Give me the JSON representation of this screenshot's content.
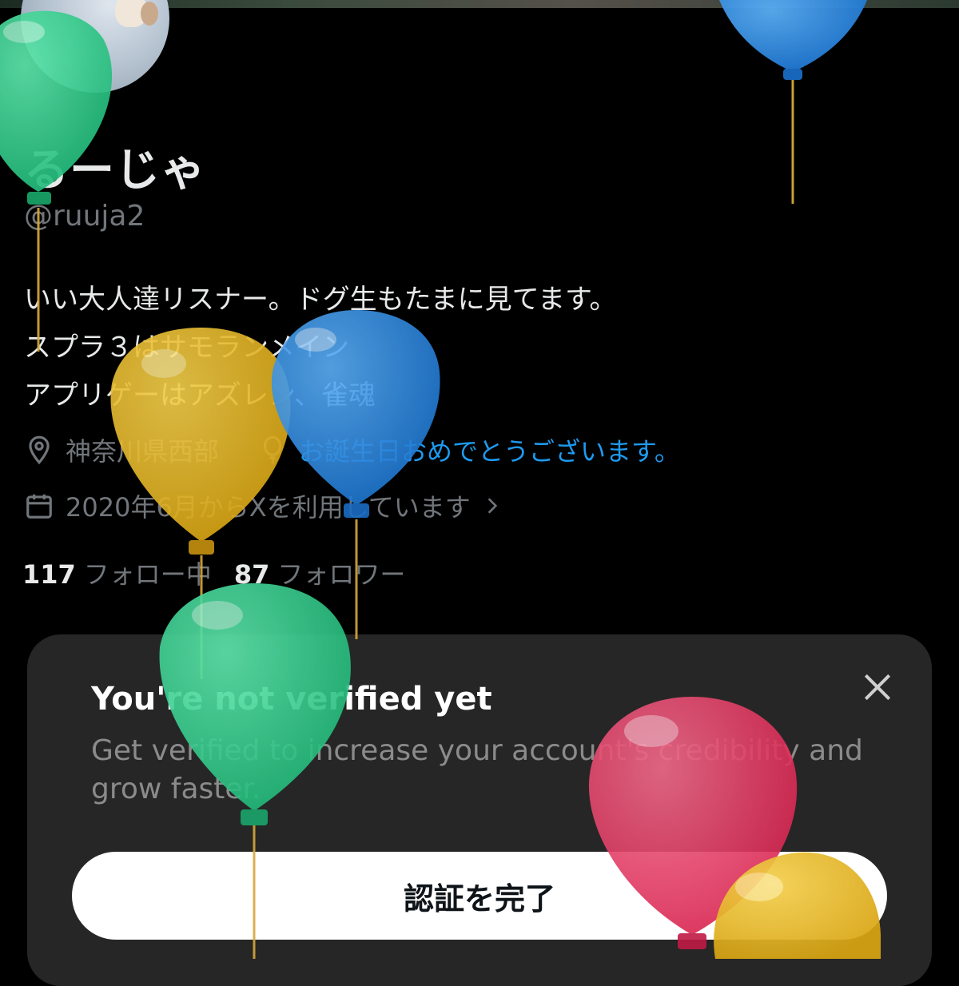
{
  "profile": {
    "display_name": "るーじゃ",
    "handle": "@ruuja2",
    "bio": "いい大人達リスナー。ドグ生もたまに見てます。\nスプラ３はサモランメイン\nアプリゲーはアズレン、雀魂",
    "location": "神奈川県西部",
    "birthday": "お誕生日おめでとうございます。",
    "joined": "2020年6月からXを利用しています"
  },
  "stats": {
    "following_count": "117",
    "following_label": "フォロー中",
    "followers_count": "87",
    "followers_label": "フォロワー"
  },
  "verify_card": {
    "title": "You're not verified yet",
    "subtitle": "Get verified to increase your account's credibility and grow faster.",
    "button_label": "認証を完了"
  },
  "colors": {
    "background": "#000000",
    "link_blue": "#1d9bf0",
    "muted_gray": "#71767b",
    "card_bg": "#262626",
    "balloon_green": "#2fd08a",
    "balloon_blue": "#2a8be6",
    "balloon_yellow": "#e6b51f",
    "balloon_red": "#e8355f"
  },
  "icons": [
    "location-pin-icon",
    "balloon-icon",
    "calendar-icon",
    "chevron-right-icon",
    "close-icon"
  ]
}
